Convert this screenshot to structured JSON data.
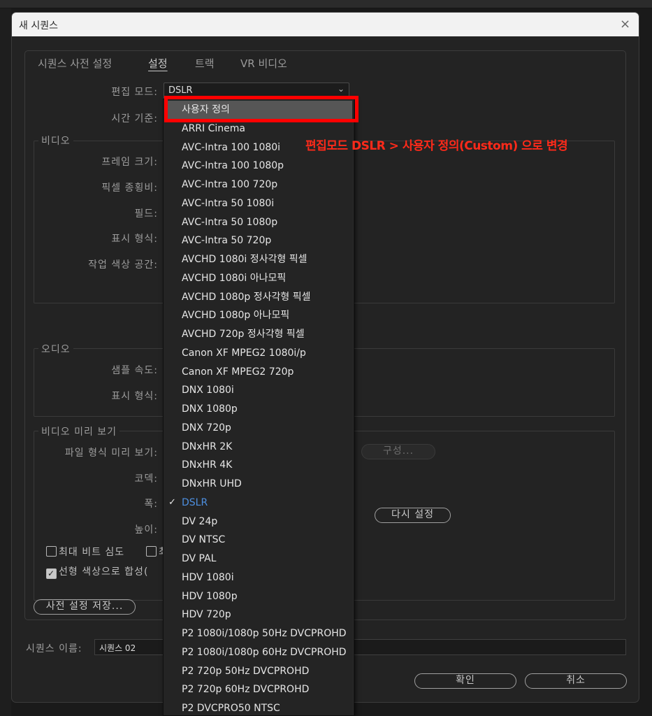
{
  "window": {
    "title": "새 시퀀스",
    "close_glyph": "×"
  },
  "tabs": [
    {
      "label": "시퀀스 사전 설정",
      "active": false
    },
    {
      "label": "설정",
      "active": true
    },
    {
      "label": "트랙",
      "active": false
    },
    {
      "label": "VR 비디오",
      "active": false
    }
  ],
  "settings": {
    "edit_mode_label": "편집 모드:",
    "edit_mode_value": "DSLR",
    "timebase_label": "시간 기준:",
    "video_group": "비디오",
    "frame_size_label": "프레임 크기:",
    "pixel_aspect_label": "픽셀 종횡비:",
    "fields_label": "필드:",
    "display_format_label": "표시 형식:",
    "working_color_label": "작업 색상 공간:",
    "audio_group": "오디오",
    "sample_rate_label": "샘플 속도:",
    "audio_display_label": "표시 형식:",
    "preview_group": "비디오 미리 보기",
    "preview_format_label": "파일 형식 미리 보기:",
    "codec_label": "코덱:",
    "width_label": "폭:",
    "height_label": "높이:",
    "configure_button": "구성...",
    "reset_button": "다시 설정",
    "max_bit_depth": "최대 비트 심도",
    "max_bit_depth_checked": false,
    "second_checkbox_partial": "최",
    "linear_color": "선형 색상으로 합성(",
    "linear_color_checked": true
  },
  "footer": {
    "save_preset_button": "사전 설정 저장...",
    "sequence_name_label": "시퀀스 이름:",
    "sequence_name_value": "시퀀스 02",
    "ok_button": "확인",
    "cancel_button": "취소"
  },
  "dropdown": {
    "selected": "DSLR",
    "highlighted": "사용자 정의",
    "check_glyph": "✓",
    "items": [
      "사용자 정의",
      "ARRI Cinema",
      "AVC-Intra 100 1080i",
      "AVC-Intra 100 1080p",
      "AVC-Intra 100 720p",
      "AVC-Intra 50 1080i",
      "AVC-Intra 50 1080p",
      "AVC-Intra 50 720p",
      "AVCHD 1080i 정사각형 픽셀",
      "AVCHD 1080i 아나모픽",
      "AVCHD 1080p 정사각형 픽셀",
      "AVCHD 1080p 아나모픽",
      "AVCHD 720p 정사각형 픽셀",
      "Canon XF MPEG2 1080i/p",
      "Canon XF MPEG2 720p",
      "DNX 1080i",
      "DNX 1080p",
      "DNX 720p",
      "DNxHR 2K",
      "DNxHR 4K",
      "DNxHR UHD",
      "DSLR",
      "DV 24p",
      "DV NTSC",
      "DV PAL",
      "HDV 1080i",
      "HDV 1080p",
      "HDV 720p",
      "P2 1080i/1080p 50Hz DVCPROHD",
      "P2 1080i/1080p 60Hz DVCPROHD",
      "P2 720p 50Hz DVCPROHD",
      "P2 720p 60Hz DVCPROHD",
      "P2 DVCPRO50 NTSC"
    ]
  },
  "annotation": {
    "text": "편집모드 DSLR > 사용자 정의(Custom) 으로 변경",
    "color": "#ff2a1a",
    "box_color": "#ff0000"
  },
  "colors": {
    "selected_item": "#4d8fe0",
    "highlight_bg": "#565656",
    "dialog_bg": "#232323"
  }
}
